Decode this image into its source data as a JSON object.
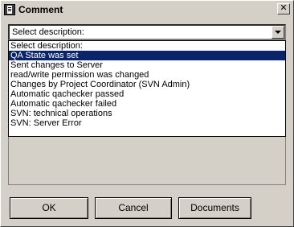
{
  "window": {
    "title": "Comment",
    "close_glyph": "✕"
  },
  "combo": {
    "selected": "Select description:"
  },
  "dropdown": {
    "items": [
      "Select description:",
      "QA State was set",
      "Sent changes to Server",
      "read/write permission was changed",
      "Changes by Project Coordinator (SVN Admin)",
      "Automatic qachecker passed",
      "Automatic qachecker failed",
      "SVN: technical operations",
      "SVN: Server Error"
    ],
    "highlighted_index": 1
  },
  "buttons": {
    "ok": "OK",
    "cancel": "Cancel",
    "documents": "Documents"
  },
  "colors": {
    "highlight": "#0a246a",
    "face": "#d4d0c8"
  }
}
